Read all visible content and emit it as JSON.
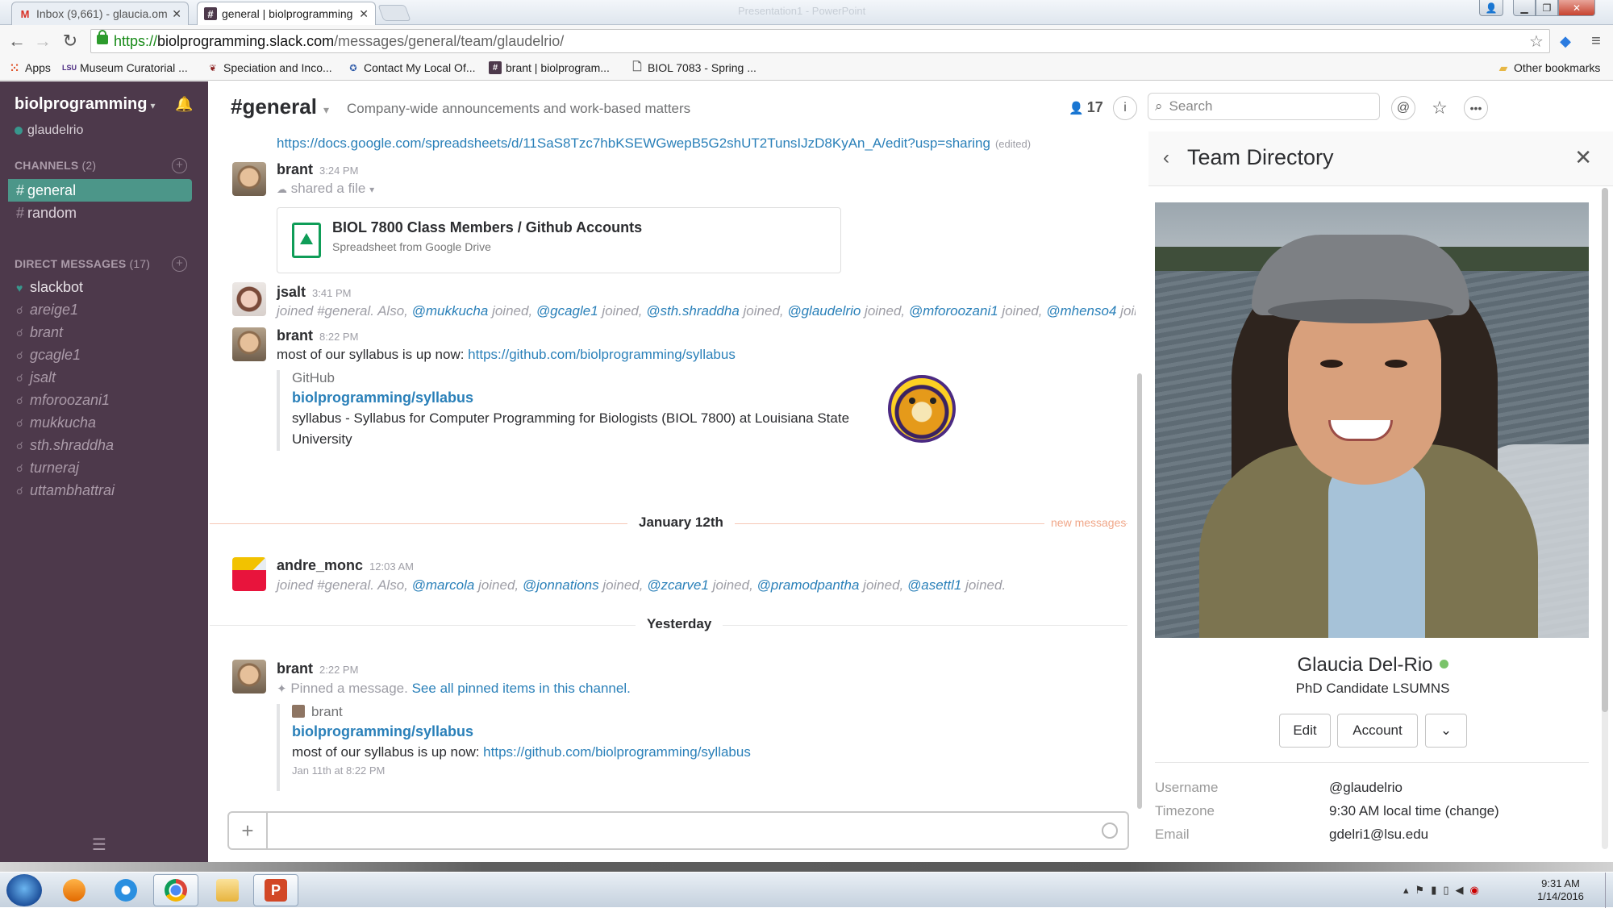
{
  "browser": {
    "tabs": [
      {
        "icon": "gmail-icon",
        "label": "Inbox (9,661) - glaucia.om",
        "active": false
      },
      {
        "icon": "slack-hash-icon",
        "label": "general | biolprogramming",
        "active": true
      }
    ],
    "background_window_title": "Presentation1 - PowerPoint",
    "url": {
      "scheme": "https://",
      "host": "biolprogramming.slack.com",
      "path": "/messages/general/team/glaudelrio/"
    },
    "bookmarks": [
      {
        "icon": "apps-grid-icon",
        "label": "Apps"
      },
      {
        "icon": "lsu-icon",
        "label": "Museum Curatorial ..."
      },
      {
        "icon": "bird-icon",
        "label": "Speciation and Inco..."
      },
      {
        "icon": "capitol-seal-icon",
        "label": "Contact My Local Of..."
      },
      {
        "icon": "slack-hash-icon",
        "label": "brant | biolprogram..."
      },
      {
        "icon": "document-icon",
        "label": "BIOL 7083 - Spring ..."
      }
    ],
    "other_bookmarks": "Other bookmarks"
  },
  "sidebar": {
    "team": "biolprogramming",
    "user": "glaudelrio",
    "channels_header": "CHANNELS",
    "channels_count": "(2)",
    "channels": [
      {
        "name": "general",
        "active": true
      },
      {
        "name": "random",
        "active": false
      }
    ],
    "dm_header": "DIRECT MESSAGES",
    "dm_count": "(17)",
    "dms": [
      {
        "name": "slackbot",
        "status": "online"
      },
      {
        "name": "areige1",
        "status": "away"
      },
      {
        "name": "brant",
        "status": "away"
      },
      {
        "name": "gcagle1",
        "status": "away"
      },
      {
        "name": "jsalt",
        "status": "away"
      },
      {
        "name": "mforoozani1",
        "status": "away"
      },
      {
        "name": "mukkucha",
        "status": "away"
      },
      {
        "name": "sth.shraddha",
        "status": "away"
      },
      {
        "name": "turneraj",
        "status": "away"
      },
      {
        "name": "uttambhattrai",
        "status": "away"
      }
    ]
  },
  "channel": {
    "name": "#general",
    "purpose": "Company-wide announcements and work-based matters",
    "member_count": "17",
    "search_placeholder": "Search"
  },
  "messages": {
    "top_link": "https://docs.google.com/spreadsheets/d/11SaS8Tzc7hbKSEWGwepB5G2shUT2TunsIJzD8KyAn_A/edit?usp=sharing",
    "top_link_edited": "(edited)",
    "m1": {
      "author": "brant",
      "time": "3:24 PM",
      "action": "shared a file",
      "file_title": "BIOL 7800 Class Members / Github Accounts",
      "file_sub": "Spreadsheet from Google Drive"
    },
    "m2": {
      "author": "jsalt",
      "time": "3:41 PM",
      "parts": [
        {
          "t": "joined #general. Also, ",
          "m": false
        },
        {
          "t": "@mukkucha",
          "m": true
        },
        {
          "t": " joined, ",
          "m": false
        },
        {
          "t": "@gcagle1",
          "m": true
        },
        {
          "t": " joined, ",
          "m": false
        },
        {
          "t": "@sth.shraddha",
          "m": true
        },
        {
          "t": " joined, ",
          "m": false
        },
        {
          "t": "@glaudelrio",
          "m": true
        },
        {
          "t": " joined, ",
          "m": false
        },
        {
          "t": "@mforoozani1",
          "m": true
        },
        {
          "t": " joined, ",
          "m": false
        },
        {
          "t": "@mhenso4",
          "m": true
        },
        {
          "t": " joined.",
          "m": false
        }
      ]
    },
    "m3": {
      "author": "brant",
      "time": "8:22 PM",
      "text": "most of our syllabus is up now: ",
      "link": "https://github.com/biolprogramming/syllabus",
      "att_service": "GitHub",
      "att_title": "biolprogramming/syllabus",
      "att_text_1": "syllabus - Syllabus for Computer Programming for Biologists (BIOL 7800) at Louisiana State",
      "att_text_2": "University"
    },
    "day1": "January 12th",
    "new_messages": "new messages",
    "m4": {
      "author": "andre_monc",
      "time": "12:03 AM",
      "parts": [
        {
          "t": "joined #general. Also, ",
          "m": false
        },
        {
          "t": "@marcola",
          "m": true
        },
        {
          "t": " joined, ",
          "m": false
        },
        {
          "t": "@jonnations",
          "m": true
        },
        {
          "t": " joined, ",
          "m": false
        },
        {
          "t": "@zcarve1",
          "m": true
        },
        {
          "t": " joined, ",
          "m": false
        },
        {
          "t": "@pramodpantha",
          "m": true
        },
        {
          "t": " joined, ",
          "m": false
        },
        {
          "t": "@asettl1",
          "m": true
        },
        {
          "t": " joined.",
          "m": false
        }
      ]
    },
    "day2": "Yesterday",
    "m5": {
      "author": "brant",
      "time": "2:22 PM",
      "action": "Pinned a message.",
      "action_link": "See all pinned items in this channel.",
      "pin_author": "brant",
      "pin_title": "biolprogramming/syllabus",
      "pin_text": "most of our syllabus is up now: ",
      "pin_link": "https://github.com/biolprogramming/syllabus",
      "pin_date": "Jan 11th at 8:22 PM"
    }
  },
  "team_directory": {
    "title": "Team Directory",
    "name": "Glaucia Del-Rio",
    "role": "PhD Candidate LSUMNS",
    "buttons": {
      "edit": "Edit",
      "account": "Account"
    },
    "fields": [
      {
        "label": "Username",
        "value": "@glaudelrio"
      },
      {
        "label": "Timezone",
        "value": "9:30 AM local time (change)"
      },
      {
        "label": "Email",
        "value": "gdelri1@lsu.edu"
      }
    ]
  },
  "taskbar": {
    "apps": [
      "windows-start-icon",
      "media-player-icon",
      "internet-explorer-icon",
      "chrome-icon",
      "file-explorer-icon",
      "powerpoint-icon"
    ],
    "clock_time": "9:31 AM",
    "clock_date": "1/14/2016"
  }
}
